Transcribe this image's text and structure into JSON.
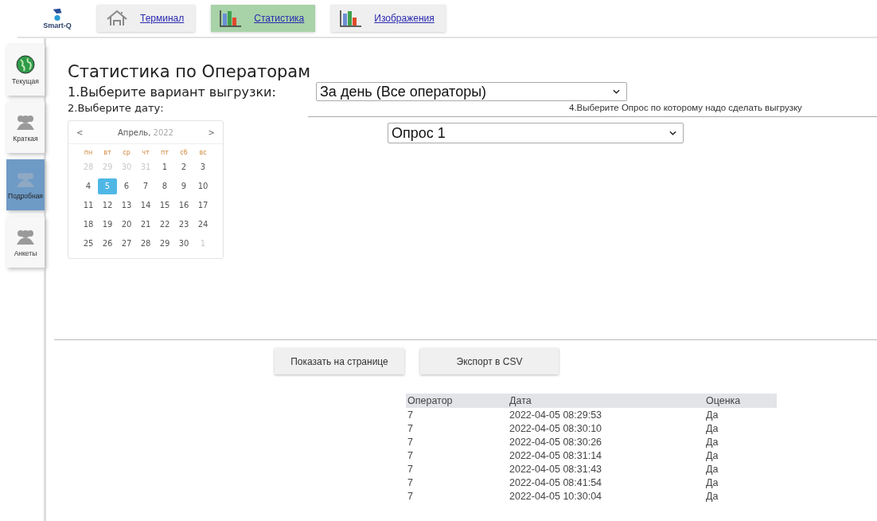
{
  "logo": {
    "label": "Smart-Q"
  },
  "tabs": [
    {
      "label": "Терминал",
      "kind": "house",
      "selected": false
    },
    {
      "label": "Статистика",
      "kind": "chart",
      "selected": true
    },
    {
      "label": "Изображения",
      "kind": "chart",
      "selected": false
    }
  ],
  "sidebar": {
    "items": [
      {
        "label": "Текущая",
        "kind": "globe",
        "selected": false
      },
      {
        "label": "Краткая",
        "kind": "people",
        "selected": false
      },
      {
        "label": "Подробная",
        "kind": "people",
        "selected": true
      },
      {
        "label": "Анкеты",
        "kind": "people",
        "selected": false
      }
    ]
  },
  "title": "Статистика по Операторам",
  "step1": {
    "label": "1.Выберите вариант выгрузки:",
    "value": "За день (Все операторы)"
  },
  "step2": {
    "label": "2.Выберите дату:"
  },
  "step4": {
    "label": "4.Выберите Опрос по которому надо сделать выгрузку",
    "value": "Опрос 1"
  },
  "calendar": {
    "prev": "<",
    "next": ">",
    "month": "Апрель,",
    "year": "2022",
    "weekdays": [
      "пн",
      "вт",
      "ср",
      "чт",
      "пт",
      "сб",
      "вс"
    ],
    "weeks": [
      [
        {
          "day": "28",
          "muted": true,
          "selected": false
        },
        {
          "day": "29",
          "muted": true,
          "selected": false
        },
        {
          "day": "30",
          "muted": true,
          "selected": false
        },
        {
          "day": "31",
          "muted": true,
          "selected": false
        },
        {
          "day": "1",
          "muted": false,
          "selected": false
        },
        {
          "day": "2",
          "muted": false,
          "selected": false
        },
        {
          "day": "3",
          "muted": false,
          "selected": false
        }
      ],
      [
        {
          "day": "4",
          "muted": false,
          "selected": false
        },
        {
          "day": "5",
          "muted": false,
          "selected": true
        },
        {
          "day": "6",
          "muted": false,
          "selected": false
        },
        {
          "day": "7",
          "muted": false,
          "selected": false
        },
        {
          "day": "8",
          "muted": false,
          "selected": false
        },
        {
          "day": "9",
          "muted": false,
          "selected": false
        },
        {
          "day": "10",
          "muted": false,
          "selected": false
        }
      ],
      [
        {
          "day": "11",
          "muted": false,
          "selected": false
        },
        {
          "day": "12",
          "muted": false,
          "selected": false
        },
        {
          "day": "13",
          "muted": false,
          "selected": false
        },
        {
          "day": "14",
          "muted": false,
          "selected": false
        },
        {
          "day": "15",
          "muted": false,
          "selected": false
        },
        {
          "day": "16",
          "muted": false,
          "selected": false
        },
        {
          "day": "17",
          "muted": false,
          "selected": false
        }
      ],
      [
        {
          "day": "18",
          "muted": false,
          "selected": false
        },
        {
          "day": "19",
          "muted": false,
          "selected": false
        },
        {
          "day": "20",
          "muted": false,
          "selected": false
        },
        {
          "day": "21",
          "muted": false,
          "selected": false
        },
        {
          "day": "22",
          "muted": false,
          "selected": false
        },
        {
          "day": "23",
          "muted": false,
          "selected": false
        },
        {
          "day": "24",
          "muted": false,
          "selected": false
        }
      ],
      [
        {
          "day": "25",
          "muted": false,
          "selected": false
        },
        {
          "day": "26",
          "muted": false,
          "selected": false
        },
        {
          "day": "27",
          "muted": false,
          "selected": false
        },
        {
          "day": "28",
          "muted": false,
          "selected": false
        },
        {
          "day": "29",
          "muted": false,
          "selected": false
        },
        {
          "day": "30",
          "muted": false,
          "selected": false
        },
        {
          "day": "1",
          "muted": true,
          "selected": false
        }
      ]
    ]
  },
  "buttons": [
    "Показать на странице",
    "Экспорт в CSV"
  ],
  "table": {
    "columns": [
      "Оператор",
      "Дата",
      "Оценка"
    ],
    "rows": [
      [
        "7",
        "2022-04-05 08:29:53",
        "Да"
      ],
      [
        "7",
        "2022-04-05 08:30:10",
        "Да"
      ],
      [
        "7",
        "2022-04-05 08:30:26",
        "Да"
      ],
      [
        "7",
        "2022-04-05 08:31:14",
        "Да"
      ],
      [
        "7",
        "2022-04-05 08:31:43",
        "Да"
      ],
      [
        "7",
        "2022-04-05 08:41:54",
        "Да"
      ],
      [
        "7",
        "2022-04-05 10:30:04",
        "Да"
      ]
    ]
  }
}
